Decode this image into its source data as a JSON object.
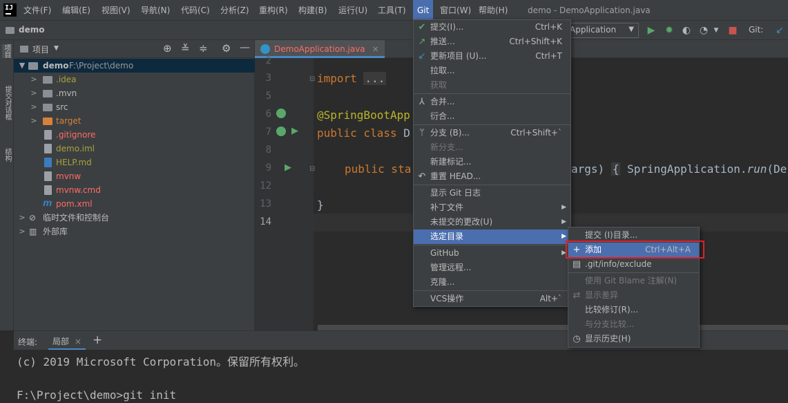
{
  "menubar": {
    "items": [
      "文件(F)",
      "编辑(E)",
      "视图(V)",
      "导航(N)",
      "代码(C)",
      "分析(Z)",
      "重构(R)",
      "构建(B)",
      "运行(U)",
      "工具(T)",
      "Git",
      "窗口(W)",
      "帮助(H)"
    ],
    "window_title": "demo - DemoApplication.java"
  },
  "navbar": {
    "project": "demo",
    "run_config": "Application",
    "git_label": "Git:"
  },
  "left_stripe": {
    "labels": [
      "项目",
      "提交对话框",
      "结构"
    ]
  },
  "project_panel": {
    "title": "项目",
    "tree": [
      {
        "label": "demo",
        "path": "F:\\Project\\demo"
      },
      {
        "label": ".idea"
      },
      {
        "label": ".mvn"
      },
      {
        "label": "src"
      },
      {
        "label": "target"
      },
      {
        "label": ".gitignore"
      },
      {
        "label": "demo.iml"
      },
      {
        "label": "HELP.md"
      },
      {
        "label": "mvnw"
      },
      {
        "label": "mvnw.cmd"
      },
      {
        "label": "pom.xml"
      },
      {
        "label": "临时文件和控制台"
      },
      {
        "label": "外部库"
      }
    ],
    "colors": {
      "orange_text": "#d5823a",
      "olive_text": "#a8a33a",
      "red_text": "#ff6b68"
    }
  },
  "editor": {
    "tab": "DemoApplication.java",
    "line_numbers": [
      "2",
      "3",
      "5",
      "6",
      "7",
      "8",
      "9",
      "12",
      "13",
      "14"
    ],
    "code": {
      "import_kw": "import",
      "import_fold": "...",
      "annotation": "@SpringBootApp",
      "class_line_kw": "public class",
      "class_line_rest": "D",
      "main_kw": "public sta",
      "main_args": "args)",
      "main_brace": "{",
      "main_call": "SpringApplication.",
      "main_run": "run",
      "main_tail": "(De",
      "close_brace": "}"
    }
  },
  "git_menu": {
    "items": [
      {
        "icon": "check-icon",
        "label": "提交(I)...",
        "shortcut": "Ctrl+K"
      },
      {
        "icon": "push-icon",
        "label": "推送…",
        "shortcut": "Ctrl+Shift+K"
      },
      {
        "icon": "update-icon",
        "label": "更新项目 (U)...",
        "shortcut": "Ctrl+T"
      },
      {
        "label": "拉取..."
      },
      {
        "label": "获取",
        "disabled": true
      },
      {
        "icon": "merge-icon",
        "label": "合并..."
      },
      {
        "label": "衍合..."
      },
      {
        "icon": "branch-icon",
        "label": "分支 (B)...",
        "shortcut": "Ctrl+Shift+`"
      },
      {
        "label": "新分支...",
        "disabled": true
      },
      {
        "label": "新建标记..."
      },
      {
        "icon": "reset-icon",
        "label": "重置 HEAD..."
      },
      {
        "label": "显示 Git 日志"
      },
      {
        "label": "补丁文件"
      },
      {
        "label": "未提交的更改(U)"
      },
      {
        "label": "选定目录"
      },
      {
        "label": "GitHub"
      },
      {
        "label": "管理远程..."
      },
      {
        "label": "克隆..."
      },
      {
        "label": "VCS操作",
        "shortcut": "Alt+`"
      }
    ]
  },
  "submenu": {
    "items": [
      {
        "label": "提交 (I)目录..."
      },
      {
        "icon": "plus-icon",
        "label": "添加",
        "shortcut": "Ctrl+Alt+A"
      },
      {
        "icon": "exclude-icon",
        "label": ".git/info/exclude"
      },
      {
        "label": "使用 Git Blame 注解(N)",
        "disabled": true
      },
      {
        "icon": "diff-icon",
        "label": "显示差异",
        "disabled": true
      },
      {
        "label": "比较修订(R)..."
      },
      {
        "label": "与分支比较...",
        "disabled": true
      },
      {
        "icon": "history-icon",
        "label": "显示历史(H)"
      }
    ]
  },
  "terminal": {
    "label": "终端:",
    "tab": "局部",
    "add": "+",
    "lines": [
      "(c) 2019 Microsoft Corporation。保留所有权利。",
      "",
      "F:\\Project\\demo>git init"
    ]
  }
}
